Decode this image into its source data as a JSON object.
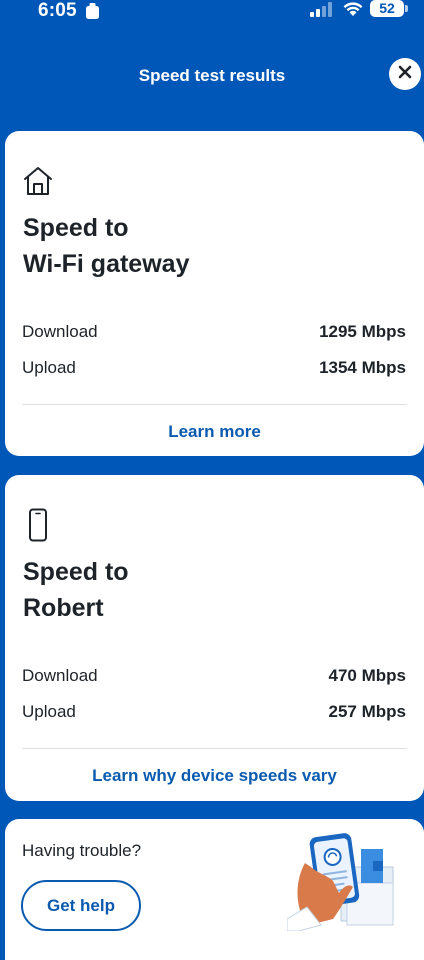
{
  "status_bar": {
    "time": "6:05",
    "battery": "52"
  },
  "header": {
    "title": "Speed test results"
  },
  "gateway_card": {
    "title_line1": "Speed to",
    "title_line2": "Wi-Fi gateway",
    "icon": "home-icon",
    "download_label": "Download",
    "download_value": "1295 Mbps",
    "upload_label": "Upload",
    "upload_value": "1354 Mbps",
    "link": "Learn more"
  },
  "device_card": {
    "title_line1": "Speed to",
    "title_line2": "Robert",
    "icon": "phone-icon",
    "download_label": "Download",
    "download_value": "470 Mbps",
    "upload_label": "Upload",
    "upload_value": "257 Mbps",
    "link": "Learn why device speeds vary"
  },
  "help_card": {
    "text": "Having trouble?",
    "button": "Get help"
  },
  "colors": {
    "brand_blue": "#0057B8",
    "link_blue": "#0a5bb0",
    "card_bg": "#ffffff",
    "text": "#1d2329"
  }
}
